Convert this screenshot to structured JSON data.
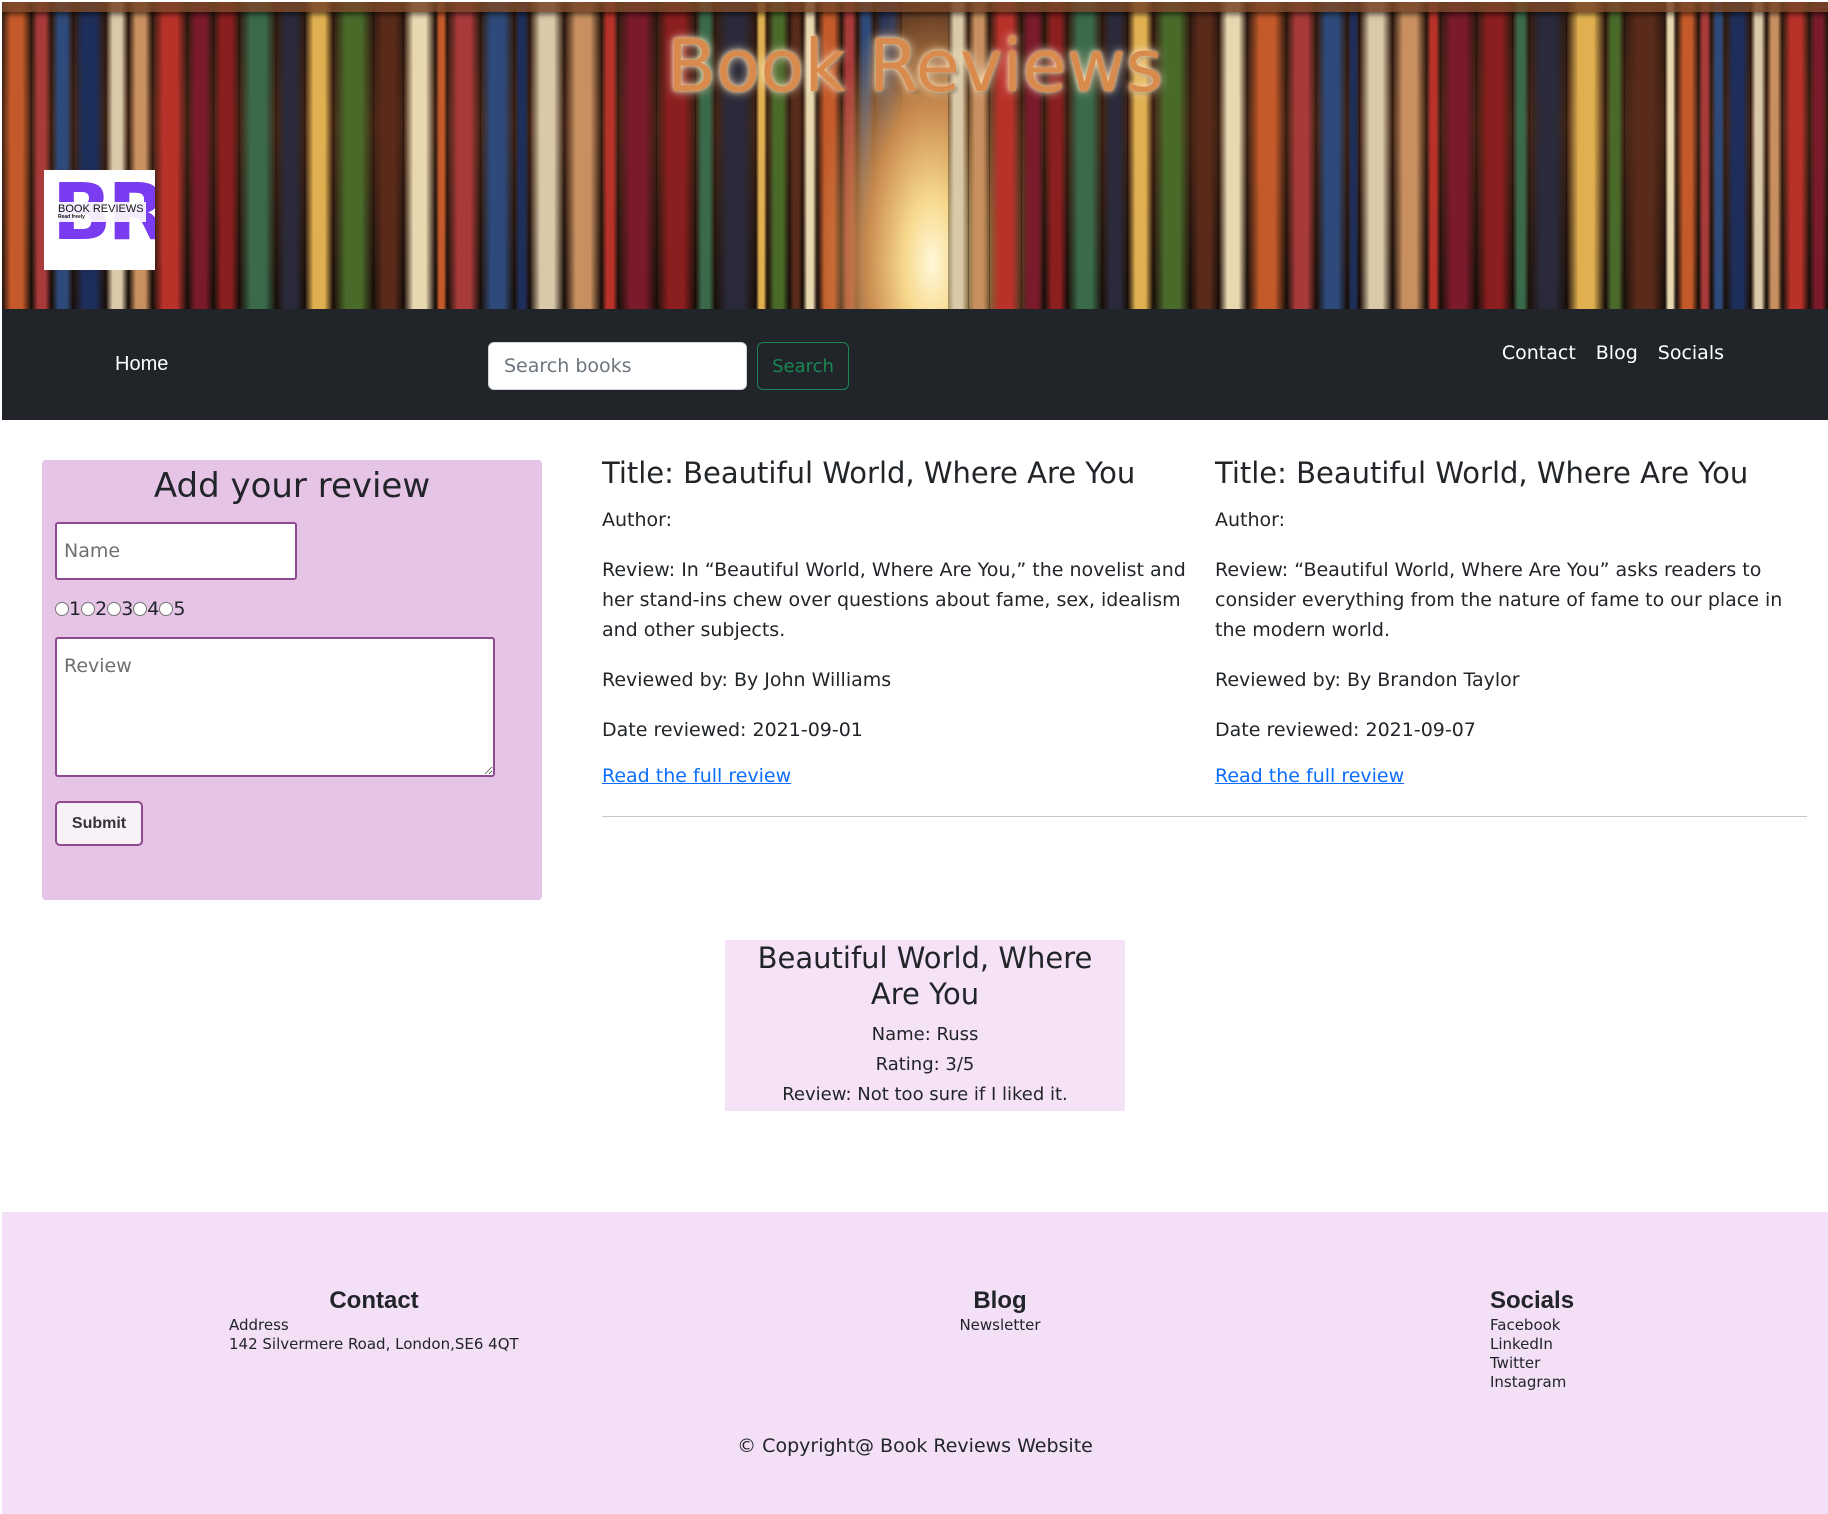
{
  "banner": {
    "title": "Book Reviews",
    "logo": {
      "letters": "BR",
      "text": "BOOK REVIEWS",
      "tagline": "Read freely"
    }
  },
  "nav": {
    "home": "Home",
    "search": {
      "placeholder": "Search books",
      "button": "Search"
    },
    "links": [
      "Contact",
      "Blog",
      "Socials"
    ]
  },
  "form": {
    "title": "Add your review",
    "name_placeholder": "Name",
    "ratings": [
      "1",
      "2",
      "3",
      "4",
      "5"
    ],
    "review_placeholder": "Review",
    "submit": "Submit"
  },
  "reviews": [
    {
      "title": "Title: Beautiful World, Where Are You",
      "author": "Author:",
      "review": "Review: In “Beautiful World, Where Are You,” the novelist and her stand-ins chew over questions about fame, sex, idealism and other subjects.",
      "reviewed_by": "Reviewed by: By John Williams",
      "date": "Date reviewed: 2021-09-01",
      "link": "Read the full review"
    },
    {
      "title": "Title: Beautiful World, Where Are You",
      "author": "Author:",
      "review": "Review: “Beautiful World, Where Are You” asks readers to consider everything from the nature of fame to our place in the modern world.",
      "reviewed_by": "Reviewed by: By Brandon Taylor",
      "date": "Date reviewed: 2021-09-07",
      "link": "Read the full review"
    }
  ],
  "submitted": {
    "title": "Beautiful World, Where Are You",
    "name": "Name: Russ",
    "rating": "Rating: 3/5",
    "review": "Review: Not too sure if I liked it."
  },
  "footer": {
    "contact": {
      "heading": "Contact",
      "lines": [
        "Address",
        "142 Silvermere Road, London,SE6 4QT"
      ]
    },
    "blog": {
      "heading": "Blog",
      "lines": [
        "Newsletter"
      ]
    },
    "socials": {
      "heading": "Socials",
      "lines": [
        "Facebook",
        "LinkedIn",
        "Twitter",
        "Instagram"
      ]
    },
    "copyright": "© Copyright@ Book Reviews Website"
  }
}
